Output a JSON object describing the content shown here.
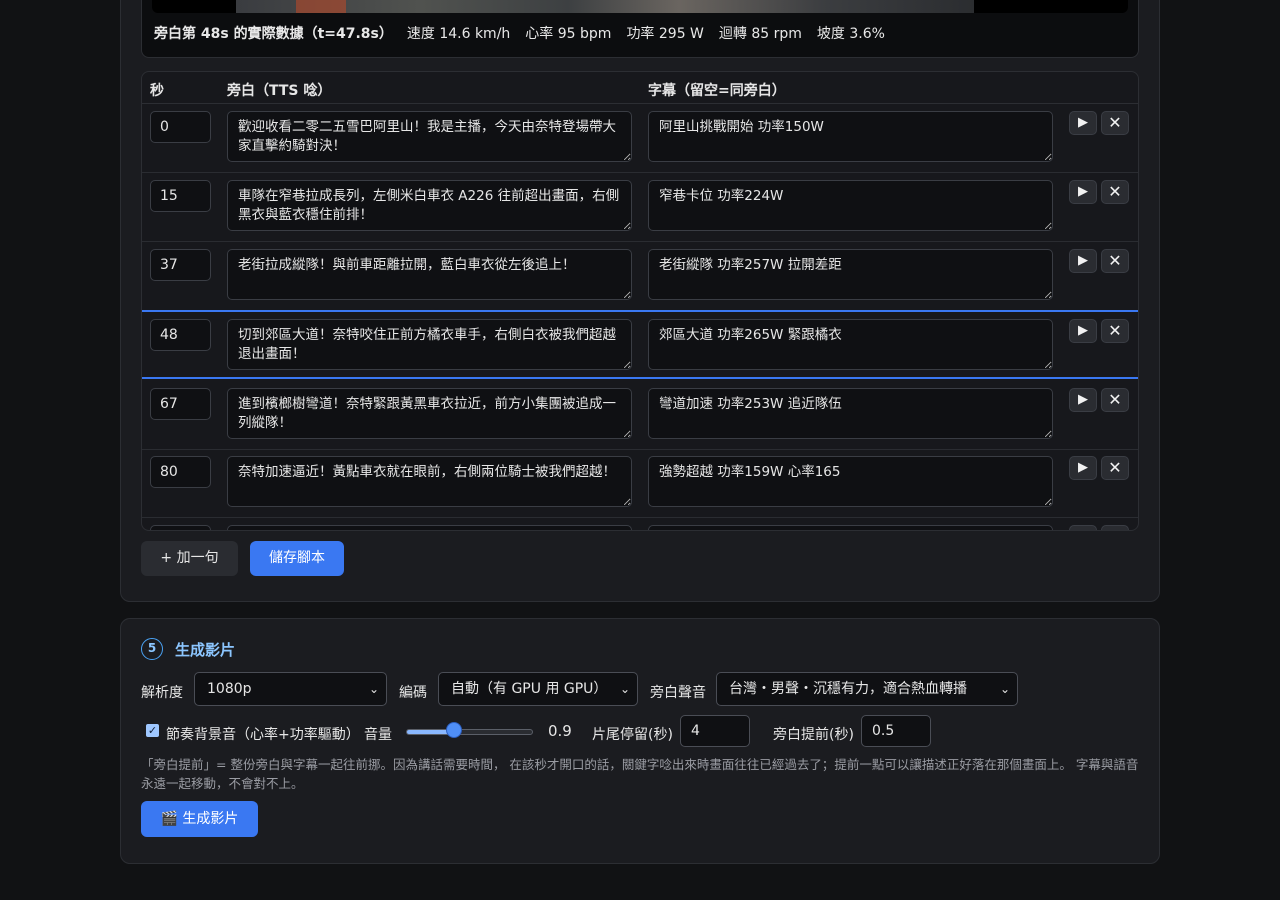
{
  "preview": {
    "lead": "旁白第 48s 的實際數據（t=47.8s）",
    "stats": [
      "速度 14.6 km/h",
      "心率 95 bpm",
      "功率 295 W",
      "迴轉 85 rpm",
      "坡度 3.6%"
    ]
  },
  "script_table": {
    "headers": {
      "sec": "秒",
      "narration": "旁白（TTS 唸）",
      "subtitle": "字幕（留空=同旁白）"
    },
    "current_row_index": 3,
    "rows": [
      {
        "sec": "0",
        "narration": "歡迎收看二零二五雪巴阿里山！我是主播，今天由奈特登場帶大家直擊約騎對決！",
        "subtitle": "阿里山挑戰開始 功率150W"
      },
      {
        "sec": "15",
        "narration": "車隊在窄巷拉成長列，左側米白車衣 A226 往前超出畫面，右側黑衣與藍衣穩住前排！",
        "subtitle": "窄巷卡位 功率224W"
      },
      {
        "sec": "37",
        "narration": "老街拉成縱隊！與前車距離拉開，藍白車衣從左後追上！",
        "subtitle": "老街縱隊 功率257W 拉開差距"
      },
      {
        "sec": "48",
        "narration": "切到郊區大道！奈特咬住正前方橘衣車手，右側白衣被我們超越退出畫面！",
        "subtitle": "郊區大道 功率265W 緊跟橘衣"
      },
      {
        "sec": "67",
        "narration": "進到檳榔樹彎道！奈特緊跟黃黑車衣拉近，前方小集團被追成一列縱隊！",
        "subtitle": "彎道加速 功率253W 追近隊伍"
      },
      {
        "sec": "80",
        "narration": "奈特加速逼近！黃點車衣就在眼前，右側兩位騎士被我們超越！",
        "subtitle": "強勢超越 功率159W 心率165"
      },
      {
        "sec": "",
        "narration": "",
        "subtitle": ""
      }
    ],
    "play_icon": "play-icon",
    "delete_icon": "close-icon"
  },
  "actions": {
    "add_line": "+ 加一句",
    "save_script": "儲存腳本"
  },
  "generate": {
    "step_number": "5",
    "title": "生成影片",
    "resolution_label": "解析度",
    "resolution_value": "1080p",
    "encoder_label": "編碼",
    "encoder_value": "自動（有 GPU 用 GPU）",
    "voice_label": "旁白聲音",
    "voice_value": "台灣・男聲・沉穩有力，適合熱血轉播",
    "bgm_checked": true,
    "bgm_label": "節奏背景音（心率+功率驅動）",
    "volume_label": "音量",
    "volume_value": "0.9",
    "volume_fraction": 0.38,
    "tail_label": "片尾停留(秒)",
    "tail_value": "4",
    "advance_label": "旁白提前(秒)",
    "advance_value": "0.5",
    "hint": "「旁白提前」= 整份旁白與字幕一起往前挪。因為講話需要時間， 在該秒才開口的話，關鍵字唸出來時畫面往往已經過去了；提前一點可以讓描述正好落在那個畫面上。 字幕與語音永遠一起移動，不會對不上。",
    "generate_button": "🎬 生成影片"
  },
  "colors": {
    "accent": "#3a78f2",
    "step": "#8cc6ff",
    "bg": "#111214",
    "card": "#1b1c20"
  }
}
